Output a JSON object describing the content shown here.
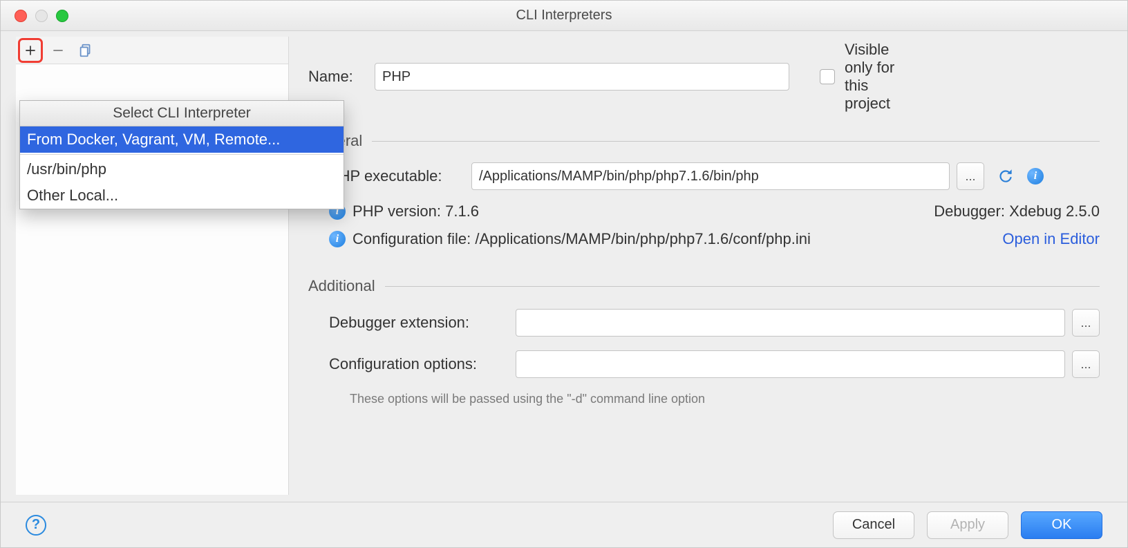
{
  "window": {
    "title": "CLI Interpreters"
  },
  "popup": {
    "title": "Select CLI Interpreter",
    "item_docker": "From Docker, Vagrant, VM, Remote...",
    "item_usrbin": "/usr/bin/php",
    "item_other": "Other Local..."
  },
  "name": {
    "label": "Name:",
    "value": "PHP"
  },
  "visible": {
    "label": "Visible only for this project"
  },
  "general": {
    "title": "General"
  },
  "exec": {
    "label": "PHP executable:",
    "value": "/Applications/MAMP/bin/php/php7.1.6/bin/php",
    "browse": "..."
  },
  "phpver": {
    "label": "PHP version:",
    "value": "7.1.6"
  },
  "debugger": {
    "label": "Debugger:",
    "value": "Xdebug 2.5.0"
  },
  "conf": {
    "label": "Configuration file:",
    "value": "/Applications/MAMP/bin/php/php7.1.6/conf/php.ini",
    "open": "Open in Editor"
  },
  "additional": {
    "title": "Additional"
  },
  "debuggerExt": {
    "label": "Debugger extension:",
    "value": "",
    "browse": "..."
  },
  "confOpts": {
    "label": "Configuration options:",
    "value": "",
    "browse": "..."
  },
  "hint": "These options will be passed using the \"-d\" command line option",
  "footer": {
    "cancel": "Cancel",
    "apply": "Apply",
    "ok": "OK"
  }
}
